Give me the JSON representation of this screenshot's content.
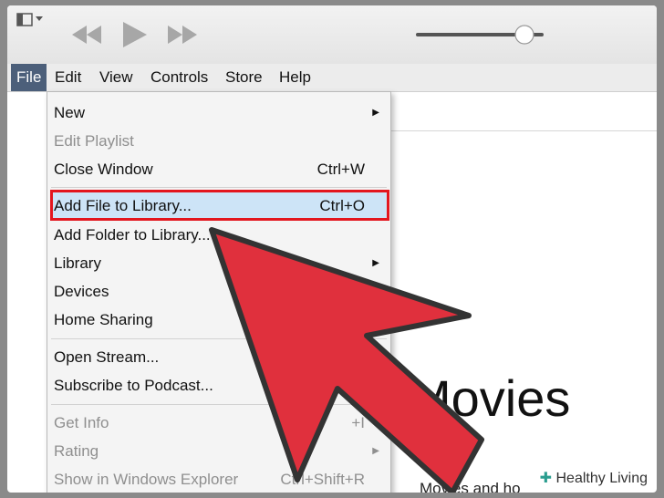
{
  "menubar": {
    "items": [
      "File",
      "Edit",
      "View",
      "Controls",
      "Store",
      "Help"
    ]
  },
  "file_menu": {
    "items": [
      {
        "label": "New",
        "shortcut": "",
        "submenu": true,
        "disabled": false
      },
      {
        "label": "Edit Playlist",
        "shortcut": "",
        "submenu": false,
        "disabled": true
      },
      {
        "label": "Close Window",
        "shortcut": "Ctrl+W",
        "submenu": false,
        "disabled": false
      },
      {
        "label": "Add File to Library...",
        "shortcut": "Ctrl+O",
        "submenu": false,
        "disabled": false,
        "highlighted": true
      },
      {
        "label": "Add Folder to Library...",
        "shortcut": "",
        "submenu": false,
        "disabled": false
      },
      {
        "label": "Library",
        "shortcut": "",
        "submenu": true,
        "disabled": false
      },
      {
        "label": "Devices",
        "shortcut": "",
        "submenu": false,
        "disabled": false
      },
      {
        "label": "Home Sharing",
        "shortcut": "",
        "submenu": false,
        "disabled": false
      },
      {
        "label": "Open Stream...",
        "shortcut": "",
        "submenu": false,
        "disabled": false
      },
      {
        "label": "Subscribe to Podcast...",
        "shortcut": "",
        "submenu": false,
        "disabled": false
      },
      {
        "label": "Get Info",
        "shortcut": "+I",
        "submenu": false,
        "disabled": true
      },
      {
        "label": "Rating",
        "shortcut": "",
        "submenu": true,
        "disabled": true
      },
      {
        "label": "Show in Windows Explorer",
        "shortcut": "Ctrl+Shift+R",
        "submenu": false,
        "disabled": true
      }
    ]
  },
  "content": {
    "title": "Movies",
    "subtitle": "Movies and ho"
  },
  "watermark": {
    "text": "Healthy Living"
  },
  "colors": {
    "highlight_border": "#e3161e",
    "highlight_fill": "#cde4f7",
    "arrow": "#e0303d",
    "active_menu": "#4c5f7a"
  },
  "volume": {
    "level": 0.85
  }
}
